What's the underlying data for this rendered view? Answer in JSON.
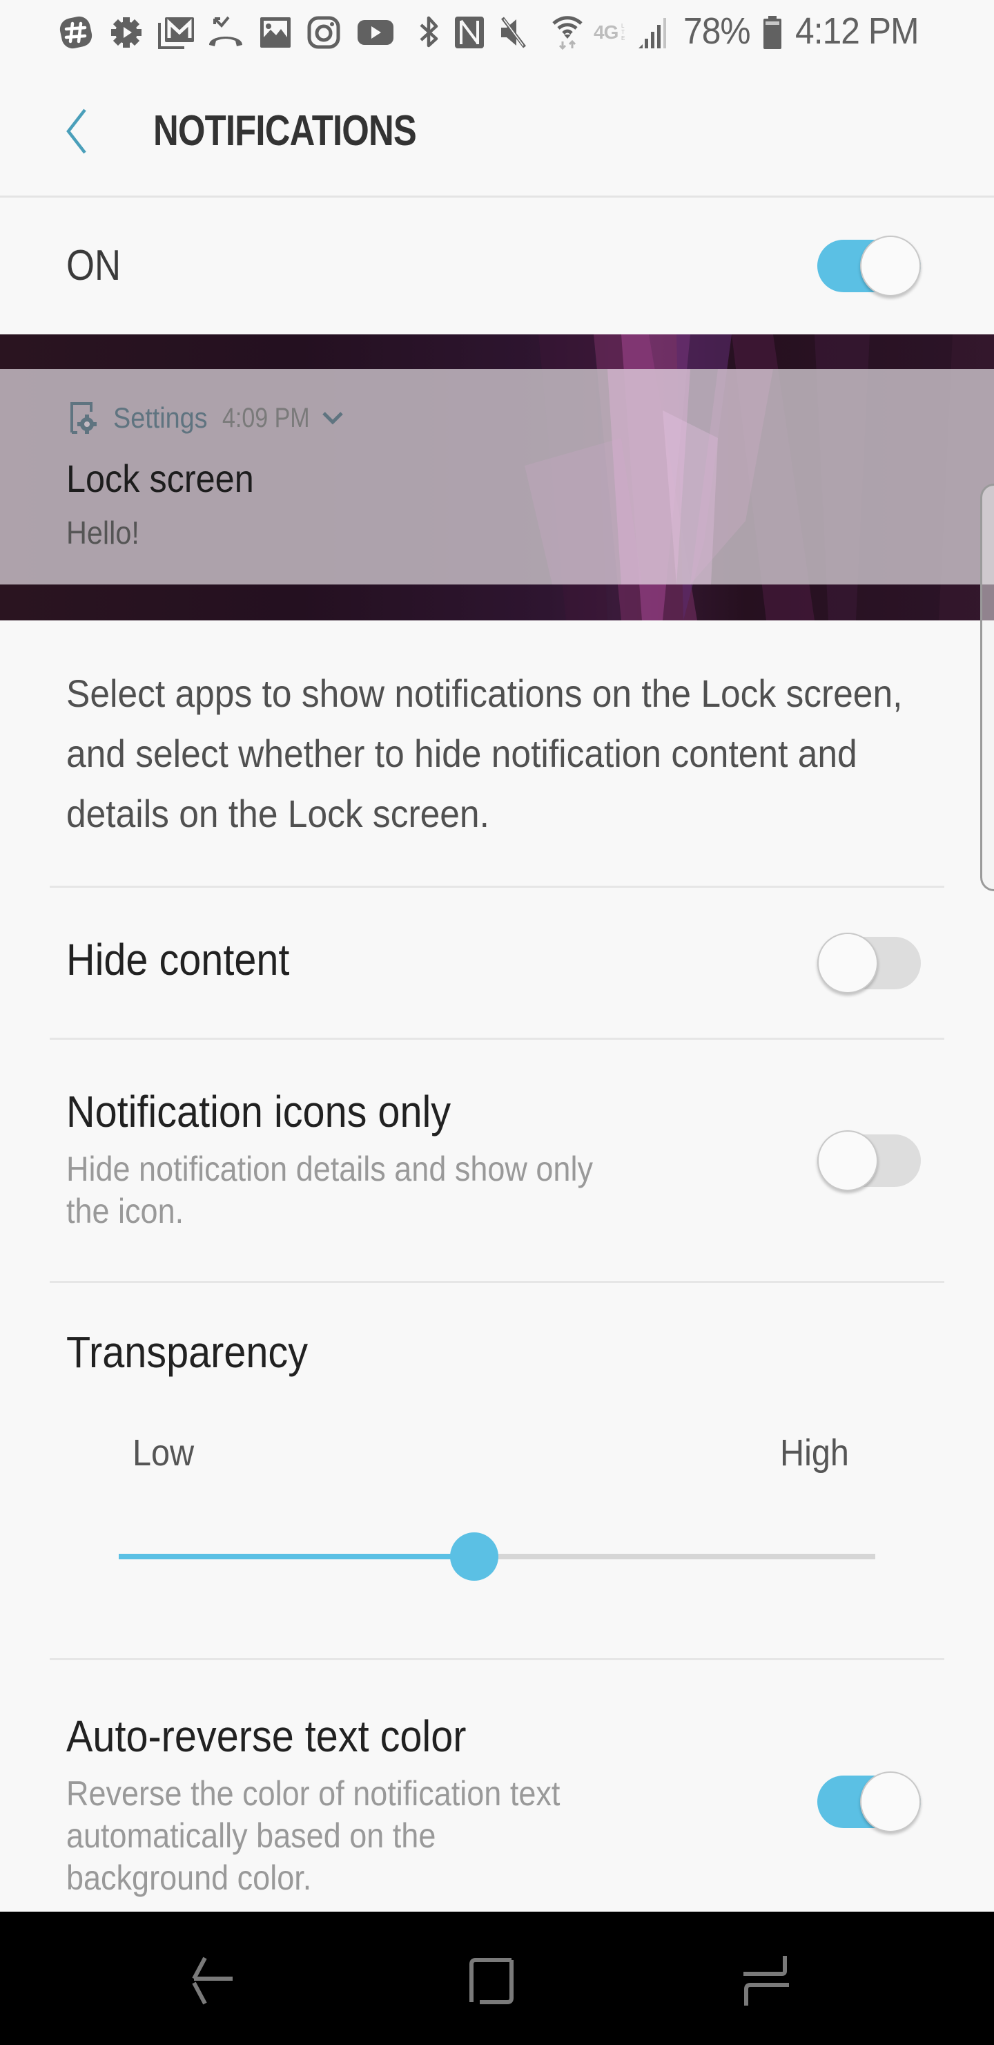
{
  "status_bar": {
    "left_icons": [
      "slack-icon",
      "settings-gear-icon",
      "gmail-icon",
      "missed-call-icon",
      "gallery-icon",
      "instagram-icon",
      "youtube-icon"
    ],
    "right_icons": [
      "bluetooth-icon",
      "nfc-icon",
      "mute-icon",
      "wifi-icon",
      "4g-lte-icon",
      "signal-icon"
    ],
    "battery": "78%",
    "time": "4:12 PM"
  },
  "header": {
    "title": "NOTIFICATIONS",
    "back_icon": "chevron-left-icon"
  },
  "master_switch": {
    "label": "ON",
    "enabled": true
  },
  "preview": {
    "app_name": "Settings",
    "time": "4:09 PM",
    "title": "Lock screen",
    "body": "Hello!"
  },
  "description": "Select apps to show notifications on the Lock screen, and select whether to hide notification content and details on the Lock screen.",
  "settings": {
    "hide_content": {
      "title": "Hide content",
      "enabled": false
    },
    "icons_only": {
      "title": "Notification icons only",
      "subtitle": "Hide notification details and show only the icon.",
      "enabled": false
    },
    "transparency": {
      "title": "Transparency",
      "low_label": "Low",
      "high_label": "High",
      "value_fraction": 0.47
    },
    "auto_reverse": {
      "title": "Auto-reverse text color",
      "subtitle": "Reverse the color of notification text automatically based on the background color.",
      "enabled": true
    }
  },
  "nav_bar": {
    "back": "back-icon",
    "home": "home-icon",
    "recents": "recents-icon"
  },
  "colors": {
    "accent": "#5bc0e4",
    "back_chevron": "#4a9fba",
    "toggle_off_track": "#dddddd",
    "background": "#f8f8f8"
  }
}
